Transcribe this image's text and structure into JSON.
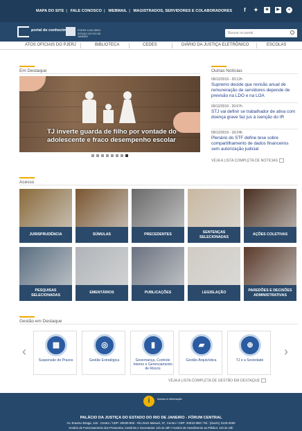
{
  "topbar": {
    "links": [
      "MAPA DO SITE",
      "FALE CONOSCO",
      "WEBMAIL",
      "MAGISTRADOS, SERVIDORES E COLABORADORES"
    ],
    "social_icons": [
      "facebook-icon",
      "twitter-icon",
      "instagram-icon",
      "youtube-icon",
      "flickr-icon"
    ]
  },
  "header": {
    "logo_title": "portal do conhecimento",
    "logo2_text": "PODER JUDICIÁRIO ESTADO DO RIO DE JANEIRO",
    "search_placeholder": "Buscar no portal"
  },
  "nav": {
    "items": [
      "ATOS OFICIAIS DO PJERJ",
      "BIBLIOTECA",
      "CEDES",
      "DIÁRIO DA JUSTIÇA ELETRÔNICO",
      "ESCOLAS"
    ]
  },
  "destaque": {
    "title": "Em Destaque",
    "caption": "TJ inverte guarda de filho por vontade do adolescente e fraco desempenho escolar",
    "slides": 8,
    "active_slide": 8
  },
  "noticias": {
    "title": "Outras Notícias",
    "items": [
      {
        "date": "09/12/2019 - 20:12h",
        "text": "Supremo decide que revisão anual de remuneração de servidores depende de previsão na LDO e na LOA"
      },
      {
        "date": "09/12/2019 - 20:07h",
        "text": "STJ vai definir se trabalhador de ativa com doença grave faz jus à isenção do IR"
      },
      {
        "date": "09/12/2019 - 18:24h",
        "text": "Plenário do STF define tese sobre compartilhamento de dados financeiros sem autorização judicial"
      }
    ],
    "more_label": "VEJA A LISTA COMPLETA DE NOTÍCIAS"
  },
  "acesso": {
    "title": "Acesso",
    "tiles": [
      {
        "label": "JURISPRUDÊNCIA",
        "bg": "#8a6a3a"
      },
      {
        "label": "SÚMULAS",
        "bg": "#7a5630"
      },
      {
        "label": "PRECEDENTES",
        "bg": "#6a6a6a"
      },
      {
        "label": "SENTENÇAS SELECIONADAS",
        "bg": "#c9b8a0"
      },
      {
        "label": "AÇÕES COLETIVAS",
        "bg": "#4a3020"
      },
      {
        "label": "PESQUISAS SELECIONADAS",
        "bg": "#5a6e80"
      },
      {
        "label": "EMENTÁRIOS",
        "bg": "#b0b4b8"
      },
      {
        "label": "PUBLICAÇÕES",
        "bg": "#6a7280"
      },
      {
        "label": "LEGISLAÇÃO",
        "bg": "#d0ccc4"
      },
      {
        "label": "PAREDÕES E DECISÕES ADMINISTRATIVAS",
        "bg": "#5a3a2a"
      }
    ]
  },
  "gestao": {
    "title": "Gestão em Destaque",
    "cards": [
      {
        "label": "Suspensão de Prazos",
        "icon": "calendar-icon",
        "glyph": "▦"
      },
      {
        "label": "Gestão Estratégica",
        "icon": "target-icon",
        "glyph": "◎"
      },
      {
        "label": "Governança, Controle Interno e Gerenciamento de Riscos",
        "icon": "chart-icon",
        "glyph": "▮"
      },
      {
        "label": "Gestão Arquivística",
        "icon": "folder-icon",
        "glyph": "▰"
      },
      {
        "label": "TJ e a Sociedade",
        "icon": "globe-icon",
        "glyph": "⊕"
      }
    ],
    "more_label": "VEJA A LISTA COMPLETA DE GESTÃO EM DESTAQUE"
  },
  "footer": {
    "info_label": "Acesso à Informação",
    "line1": "PALÁCIO DA JUSTIÇA DO ESTADO DO RIO DE JANEIRO - FÓRUM CENTRAL",
    "line2": "Av. Erasmo Braga, 115 - Centro / CEP: 20020-903 - Rio Dom Manuel, 37, Centro / CEP: 20010-090 / Tel.: (0xx21) 3133-2000",
    "line3": "Horário de Funcionamento dos Protocolos, Cartórios e Secretarias: 11h às 18h / Horário de Atendimento ao Público: 11h às 18h"
  }
}
